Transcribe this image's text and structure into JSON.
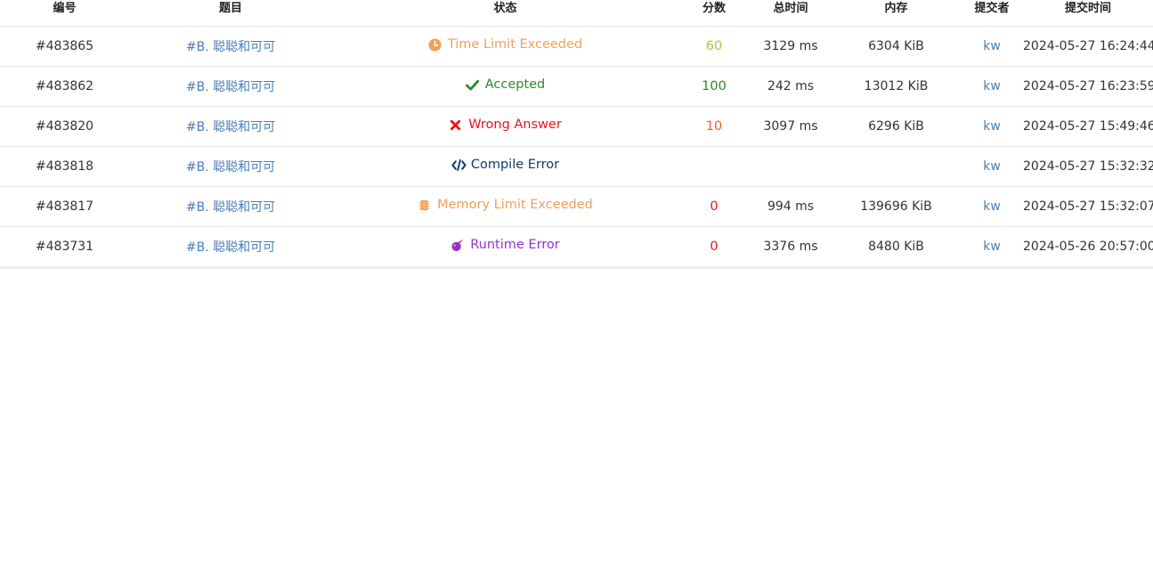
{
  "headers": {
    "id": "编号",
    "problem": "题目",
    "status": "状态",
    "score": "分数",
    "time": "总时间",
    "memory": "内存",
    "submitter": "提交者",
    "submit_time": "提交时间"
  },
  "colors": {
    "tle": "#f0a05a",
    "accepted": "#2b8a2b",
    "wrong": "#e8141c",
    "compile": "#0e3d6e",
    "mle": "#f0a05a",
    "runtime": "#9b30c8",
    "score_60": "#9acd32",
    "score_100": "#2b8a2b",
    "score_10": "#f05a28",
    "score_0": "#e8141c",
    "link": "#4a7db8"
  },
  "rows": [
    {
      "id": "#483865",
      "problem": "#B. 聪聪和可可",
      "status": "Time Limit Exceeded",
      "status_icon": "clock-icon",
      "score": "60",
      "time": "3129 ms",
      "memory": "6304 KiB",
      "submitter": "kw",
      "submit_time": "2024-05-27 16:24:44"
    },
    {
      "id": "#483862",
      "problem": "#B. 聪聪和可可",
      "status": "Accepted",
      "status_icon": "check-icon",
      "score": "100",
      "time": "242 ms",
      "memory": "13012 KiB",
      "submitter": "kw",
      "submit_time": "2024-05-27 16:23:59"
    },
    {
      "id": "#483820",
      "problem": "#B. 聪聪和可可",
      "status": "Wrong Answer",
      "status_icon": "cross-icon",
      "score": "10",
      "time": "3097 ms",
      "memory": "6296 KiB",
      "submitter": "kw",
      "submit_time": "2024-05-27 15:49:46"
    },
    {
      "id": "#483818",
      "problem": "#B. 聪聪和可可",
      "status": "Compile Error",
      "status_icon": "code-icon",
      "score": "",
      "time": "",
      "memory": "",
      "submitter": "kw",
      "submit_time": "2024-05-27 15:32:32"
    },
    {
      "id": "#483817",
      "problem": "#B. 聪聪和可可",
      "status": "Memory Limit Exceeded",
      "status_icon": "chip-icon",
      "score": "0",
      "time": "994 ms",
      "memory": "139696 KiB",
      "submitter": "kw",
      "submit_time": "2024-05-27 15:32:07"
    },
    {
      "id": "#483731",
      "problem": "#B. 聪聪和可可",
      "status": "Runtime Error",
      "status_icon": "bomb-icon",
      "score": "0",
      "time": "3376 ms",
      "memory": "8480 KiB",
      "submitter": "kw",
      "submit_time": "2024-05-26 20:57:00"
    }
  ]
}
